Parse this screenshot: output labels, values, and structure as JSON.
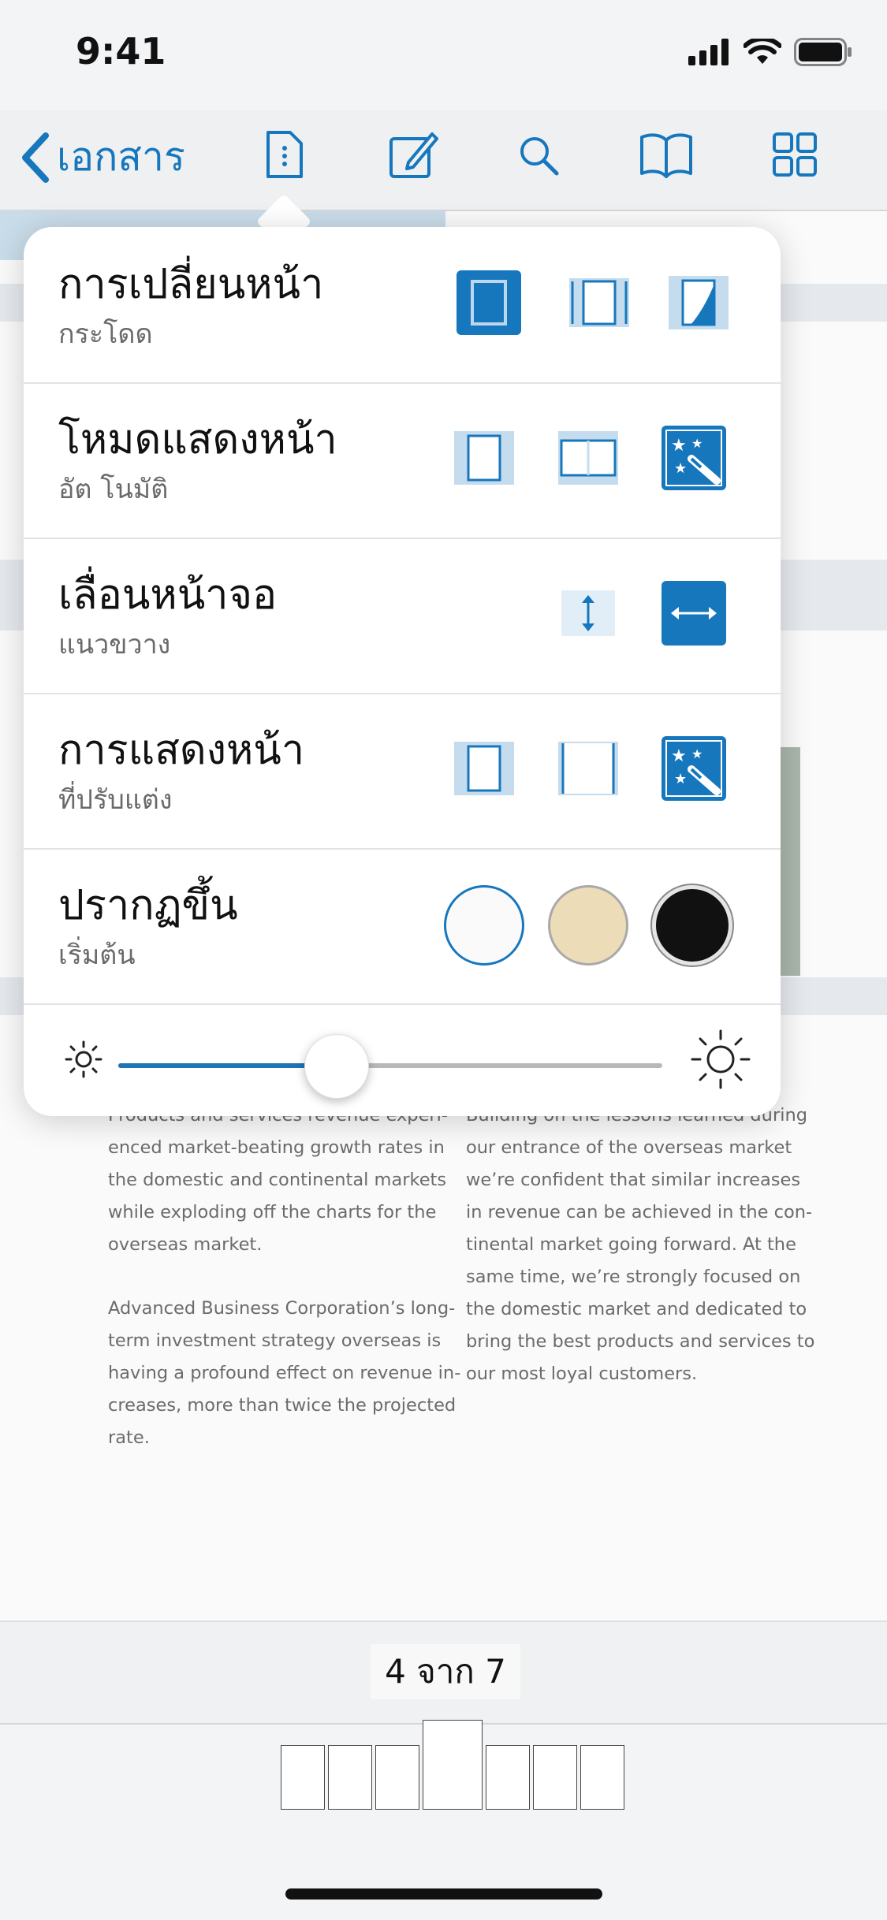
{
  "status": {
    "time": "9:41"
  },
  "nav": {
    "back_label": "เอกสาร",
    "icons": [
      "document-options-icon",
      "annotate-icon",
      "search-icon",
      "reading-book-icon",
      "grid-view-icon"
    ]
  },
  "popover": {
    "rows": [
      {
        "title": "การเปลี่ยนหน้า",
        "subtitle": "กระโดด"
      },
      {
        "title": "โหมดแสดงหน้า",
        "subtitle": "อัต โนมัติ"
      },
      {
        "title": "เลื่อนหน้าจอ",
        "subtitle": "แนวขวาง"
      },
      {
        "title": "การแสดงหน้า",
        "subtitle": "ที่ปรับแต่ง"
      },
      {
        "title": "ปรากฏขึ้น",
        "subtitle": "เริ่มต้น"
      }
    ],
    "appearance_colors": [
      "#ffffff",
      "#ecdcb7",
      "#111111"
    ],
    "accent": "#1777bd",
    "brightness": 0.4
  },
  "document": {
    "left_column": [
      "Products and services revenue experi-\nenced market-beating growth rates in\nthe domestic and continental markets\nwhile exploding off the charts for the\noverseas market.",
      "Advanced Business Corporation’s long-\nterm investment strategy overseas is\nhaving a profound effect on revenue in-\ncreases, more than twice the projected\nrate."
    ],
    "right_column": [
      "Building on the lessons learned during\nour entrance of the overseas market\nwe’re confident that similar increases\nin revenue can be achieved in the con-\ntinental market going forward. At the\nsame time, we’re strongly focused on\nthe domestic market and dedicated to\nbring the best products and services to\nour most loyal customers."
    ]
  },
  "page_indicator": "4 จาก 7",
  "thumbnails": {
    "count": 7,
    "current": 4
  }
}
